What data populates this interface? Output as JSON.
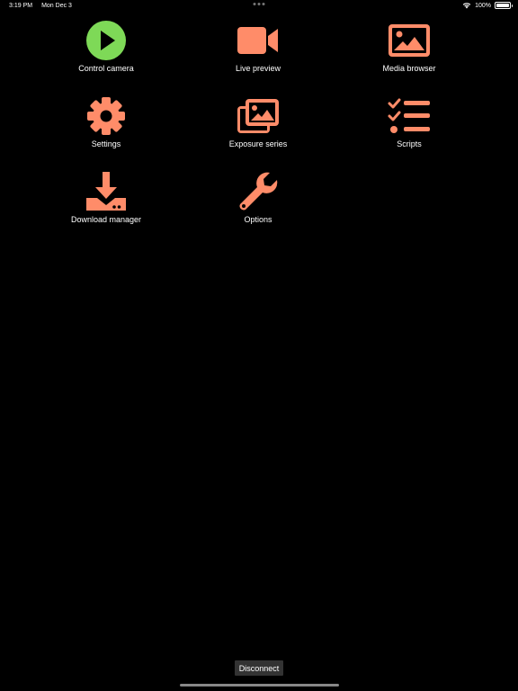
{
  "status_bar": {
    "time": "3:19 PM",
    "date": "Mon Dec 3",
    "battery": "100%",
    "battery_level": 1.0
  },
  "colors": {
    "accent": "#FF8C69",
    "play_green": "#7ED957",
    "background": "#000000",
    "button_bg": "#333333"
  },
  "menu": {
    "control_camera": {
      "label": "Control camera",
      "icon": "play-icon"
    },
    "live_preview": {
      "label": "Live preview",
      "icon": "video-camera-icon"
    },
    "media_browser": {
      "label": "Media browser",
      "icon": "image-icon"
    },
    "settings": {
      "label": "Settings",
      "icon": "gear-icon"
    },
    "exposure_series": {
      "label": "Exposure series",
      "icon": "images-stack-icon"
    },
    "scripts": {
      "label": "Scripts",
      "icon": "checklist-icon"
    },
    "download_manager": {
      "label": "Download manager",
      "icon": "download-icon"
    },
    "options": {
      "label": "Options",
      "icon": "wrench-icon"
    }
  },
  "footer": {
    "disconnect_label": "Disconnect"
  }
}
